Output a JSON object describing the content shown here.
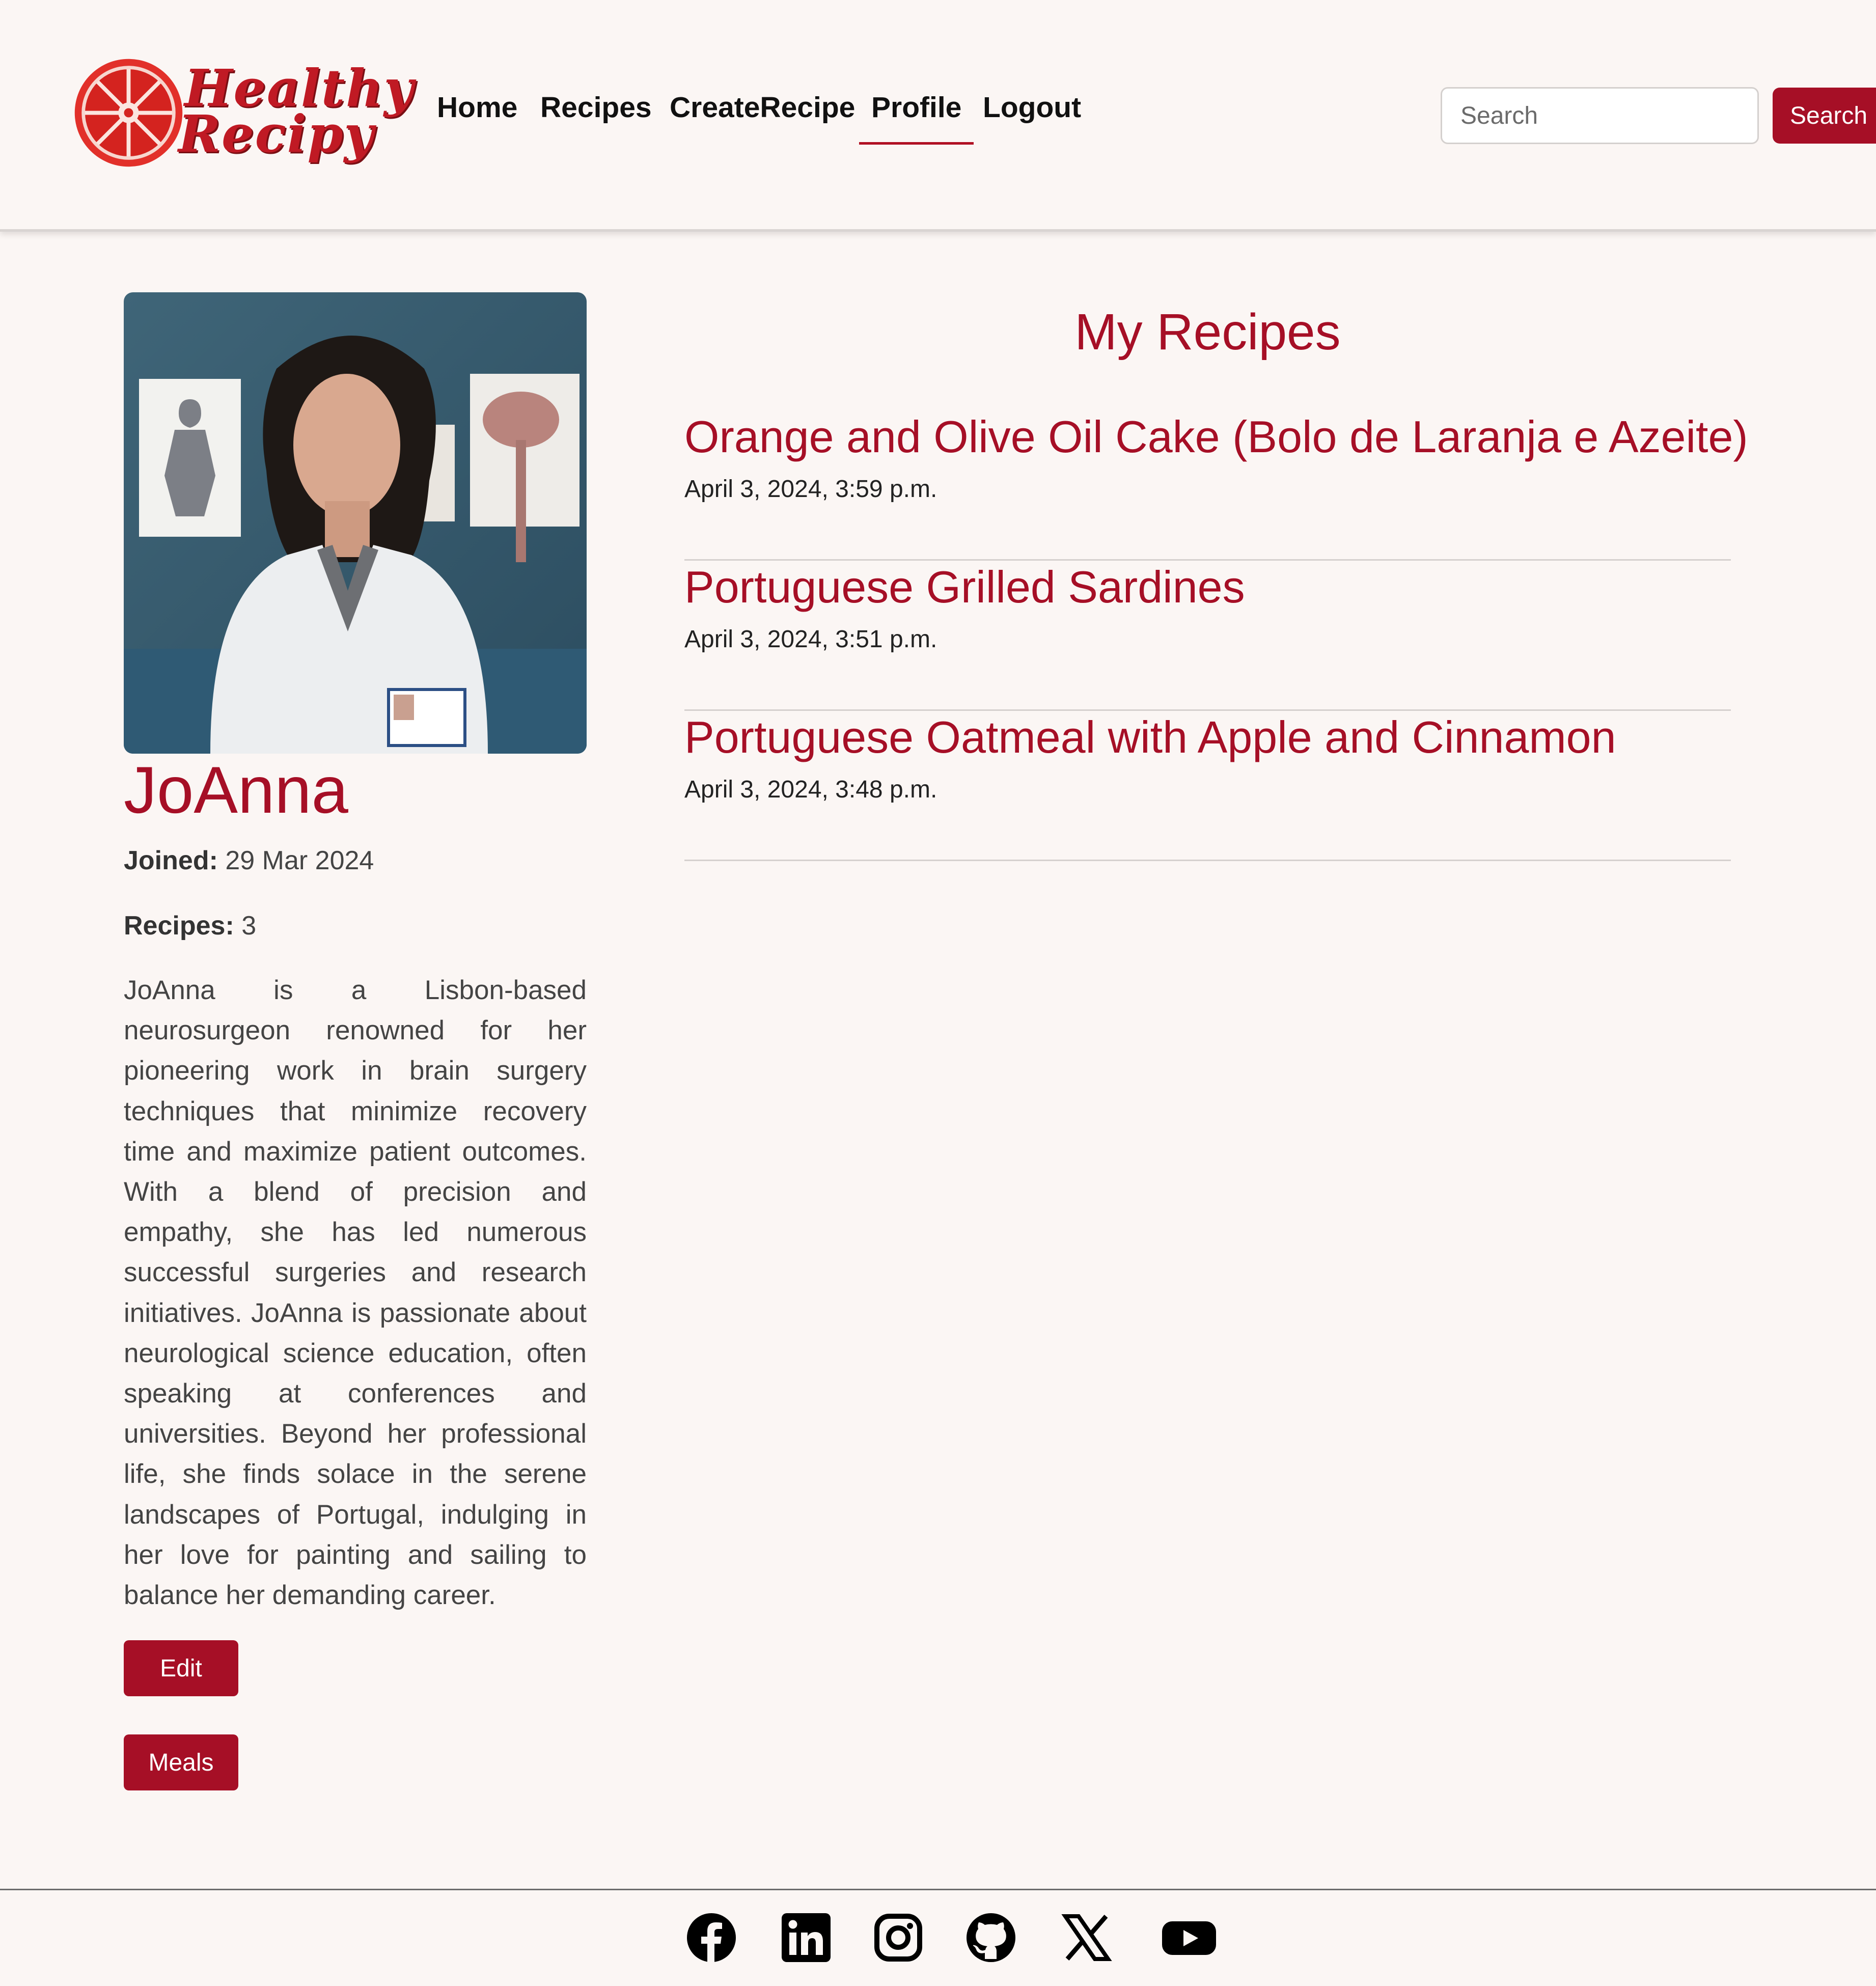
{
  "brand": {
    "logo_line1": "Healthy",
    "logo_line2": "Recipy",
    "logo_color": "#c01a24"
  },
  "nav": {
    "items": [
      {
        "label": "Home"
      },
      {
        "label": "Recipes"
      },
      {
        "label": "CreateRecipe"
      },
      {
        "label": "Profile",
        "active": true
      },
      {
        "label": "Logout"
      }
    ]
  },
  "search": {
    "placeholder": "Search",
    "value": "",
    "button_label": "Search"
  },
  "profile": {
    "name": "JoAnna",
    "joined_label": "Joined:",
    "joined_value": "29 Mar 2024",
    "recipes_label": "Recipes:",
    "recipes_value": "3",
    "bio": "JoAnna is a Lisbon-based neurosurgeon renowned for her pioneering work in brain surgery techniques that minimize recovery time and maximize patient outcomes. With a blend of precision and empathy, she has led numerous successful surgeries and research initiatives. JoAnna is passionate about neurological science education, often speaking at conferences and universities. Beyond her professional life, she finds solace in the serene landscapes of Portugal, indulging in her love for painting and sailing to balance her demanding career.",
    "edit_label": "Edit",
    "meals_label": "Meals"
  },
  "recipes": {
    "heading": "My Recipes",
    "items": [
      {
        "title": "Orange and Olive Oil Cake (Bolo de Laranja e Azeite)",
        "date": "April 3, 2024, 3:59 p.m."
      },
      {
        "title": "Portuguese Grilled Sardines",
        "date": "April 3, 2024, 3:51 p.m."
      },
      {
        "title": "Portuguese Oatmeal with Apple and Cinnamon",
        "date": "April 3, 2024, 3:48 p.m."
      }
    ]
  },
  "footer": {
    "icons": [
      "facebook-icon",
      "linkedin-icon",
      "instagram-icon",
      "github-icon",
      "x-icon",
      "youtube-icon"
    ]
  },
  "colors": {
    "accent": "#a60f26",
    "background": "#fbf6f4"
  }
}
